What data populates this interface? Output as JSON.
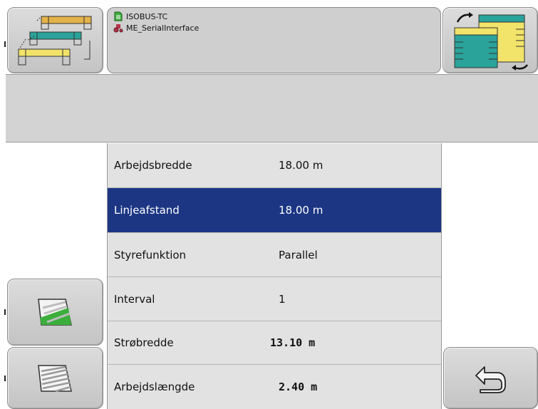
{
  "header": {
    "app_line": "ISOBUS-TC",
    "device_line": "ME_SerialInterface",
    "top_left_icon": "layout-switch-icon",
    "top_right_icon": "page-swap-icon"
  },
  "settings": [
    {
      "label": "Arbejdsbredde",
      "value": "18.00 m",
      "selected": false
    },
    {
      "label": "Linjeafstand",
      "value": "18.00 m",
      "selected": true
    },
    {
      "label": "Styrefunktion",
      "value": "Parallel",
      "selected": false
    },
    {
      "label": "Interval",
      "value": "1",
      "selected": false
    },
    {
      "label": "Strøbredde",
      "value": "13.10 m",
      "selected": false
    },
    {
      "label": "Arbejdslængde",
      "value": "2.40 m",
      "selected": false
    }
  ],
  "side_buttons": {
    "left_top_icon": "field-pattern-green-icon",
    "left_bottom_icon": "field-pattern-grey-icon",
    "right_bottom_icon": "return-arrow-icon"
  },
  "colors": {
    "selection": "#1c3684",
    "row_bg": "#e2e2e2",
    "panel_bg": "#cfcfcf",
    "accent_yellow": "#f2e36a",
    "accent_teal": "#2aa39a",
    "accent_green": "#3cae3c"
  }
}
